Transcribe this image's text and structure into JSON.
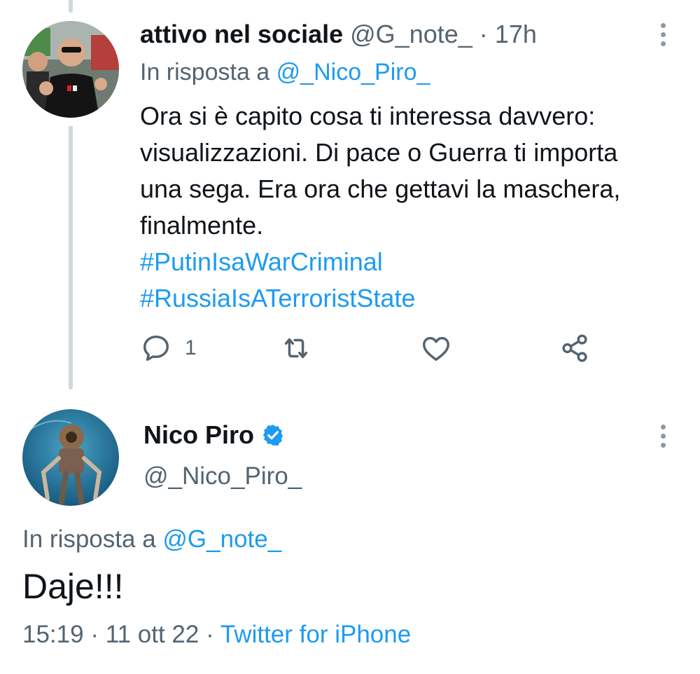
{
  "tweet1": {
    "display_name": "attivo nel sociale",
    "handle": "@G_note_",
    "separator": "·",
    "time": "17h",
    "reply_prefix": "In risposta a",
    "reply_to": "@_Nico_Piro_",
    "body_lines": [
      "Ora si è capito cosa ti interessa davvero:",
      "visualizzazioni. Di pace o Guerra ti importa",
      "una sega. Era ora che gettavi la maschera,",
      "finalmente."
    ],
    "hashtags": [
      "#PutinIsaWarCriminal",
      "#RussiaIsATerroristState"
    ],
    "reply_count": "1",
    "icons": [
      "reply-icon",
      "retweet-icon",
      "like-icon",
      "share-icon",
      "more-icon"
    ]
  },
  "tweet2": {
    "display_name": "Nico Piro",
    "handle": "@_Nico_Piro_",
    "verified": true,
    "reply_prefix": "In risposta a",
    "reply_to": "@G_note_",
    "body": "Daje!!!",
    "time": "15:19",
    "date": "11 ott 22",
    "sep1": "·",
    "sep2": "·",
    "source": "Twitter for iPhone"
  },
  "colors": {
    "link": "#1d9bf0",
    "muted": "#536471",
    "text": "#0f1419",
    "thread_line": "#cfd9de",
    "verified": "#1d9bf0"
  }
}
